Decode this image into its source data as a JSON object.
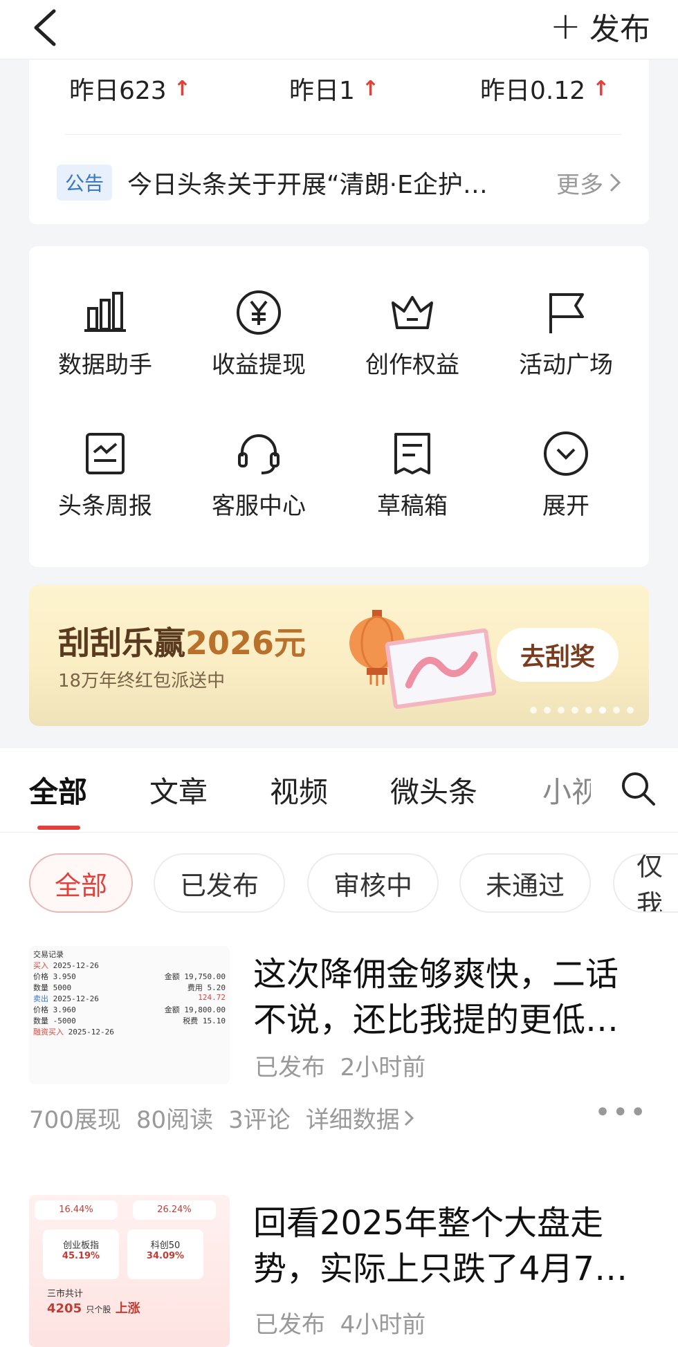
{
  "topbar": {
    "publish_label": "发布"
  },
  "stats": [
    {
      "text": "昨日623"
    },
    {
      "text": "昨日1"
    },
    {
      "text": "昨日0.12"
    }
  ],
  "notice": {
    "tag": "公告",
    "text": "今日头条关于开展“清朗·E企护…",
    "more": "更多"
  },
  "tools": [
    {
      "label": "数据助手",
      "icon": "bar-chart-icon"
    },
    {
      "label": "收益提现",
      "icon": "yuan-icon"
    },
    {
      "label": "创作权益",
      "icon": "crown-icon"
    },
    {
      "label": "活动广场",
      "icon": "flag-icon"
    },
    {
      "label": "头条周报",
      "icon": "report-icon"
    },
    {
      "label": "客服中心",
      "icon": "headset-icon"
    },
    {
      "label": "草稿箱",
      "icon": "draft-icon"
    },
    {
      "label": "展开",
      "icon": "chevron-down-icon"
    }
  ],
  "banner": {
    "title_prefix": "刮刮乐赢",
    "title_number": "2026元",
    "subtitle": "18万年终红包派送中",
    "cta": "去刮奖"
  },
  "tabs": [
    "全部",
    "文章",
    "视频",
    "微头条",
    "小视"
  ],
  "chips": [
    "全部",
    "已发布",
    "审核中",
    "未通过",
    "仅我"
  ],
  "articles": [
    {
      "title": "这次降佣金够爽快，二话不说，还比我提的更低…",
      "status": "已发布",
      "time": "2小时前",
      "views": "700展现",
      "reads": "80阅读",
      "comments": "3评论",
      "detail": "详细数据",
      "thumb": {
        "heading": "交易记录",
        "buy_label": "买入",
        "buy_date": "2025-12-26",
        "buy_price": "3.950",
        "buy_amount": "19,750.00",
        "buy_qty": "5000",
        "buy_fee": "5.20",
        "sell_label": "卖出",
        "sell_date": "2025-12-26",
        "sell_profit": "124.72",
        "sell_price": "3.960",
        "sell_amount": "19,800.00",
        "sell_qty": "-5000",
        "sell_tax": "15.10",
        "margin_label": "融资买入",
        "margin_date": "2025-12-26",
        "price_label": "价格",
        "qty_label": "数量",
        "amount_label": "金额",
        "fee_label": "费用",
        "tax_label": "税费"
      }
    },
    {
      "title": "回看2025年整个大盘走势，实际上只跌了4月7…",
      "status": "已发布",
      "time": "4小时前",
      "thumb": {
        "p1": "16.44%",
        "p2": "26.24%",
        "c1_name": "创业板指",
        "c1_val": "45.19%",
        "c2_name": "科创50",
        "c2_val": "34.09%",
        "total_label": "三市共计",
        "total_num": "4205",
        "total_unit": "只个股",
        "total_rise": "上涨"
      }
    }
  ],
  "colors": {
    "accent": "#e0413a",
    "notice_tag": "#3a78c4",
    "banner_text": "#5a3a1e"
  }
}
